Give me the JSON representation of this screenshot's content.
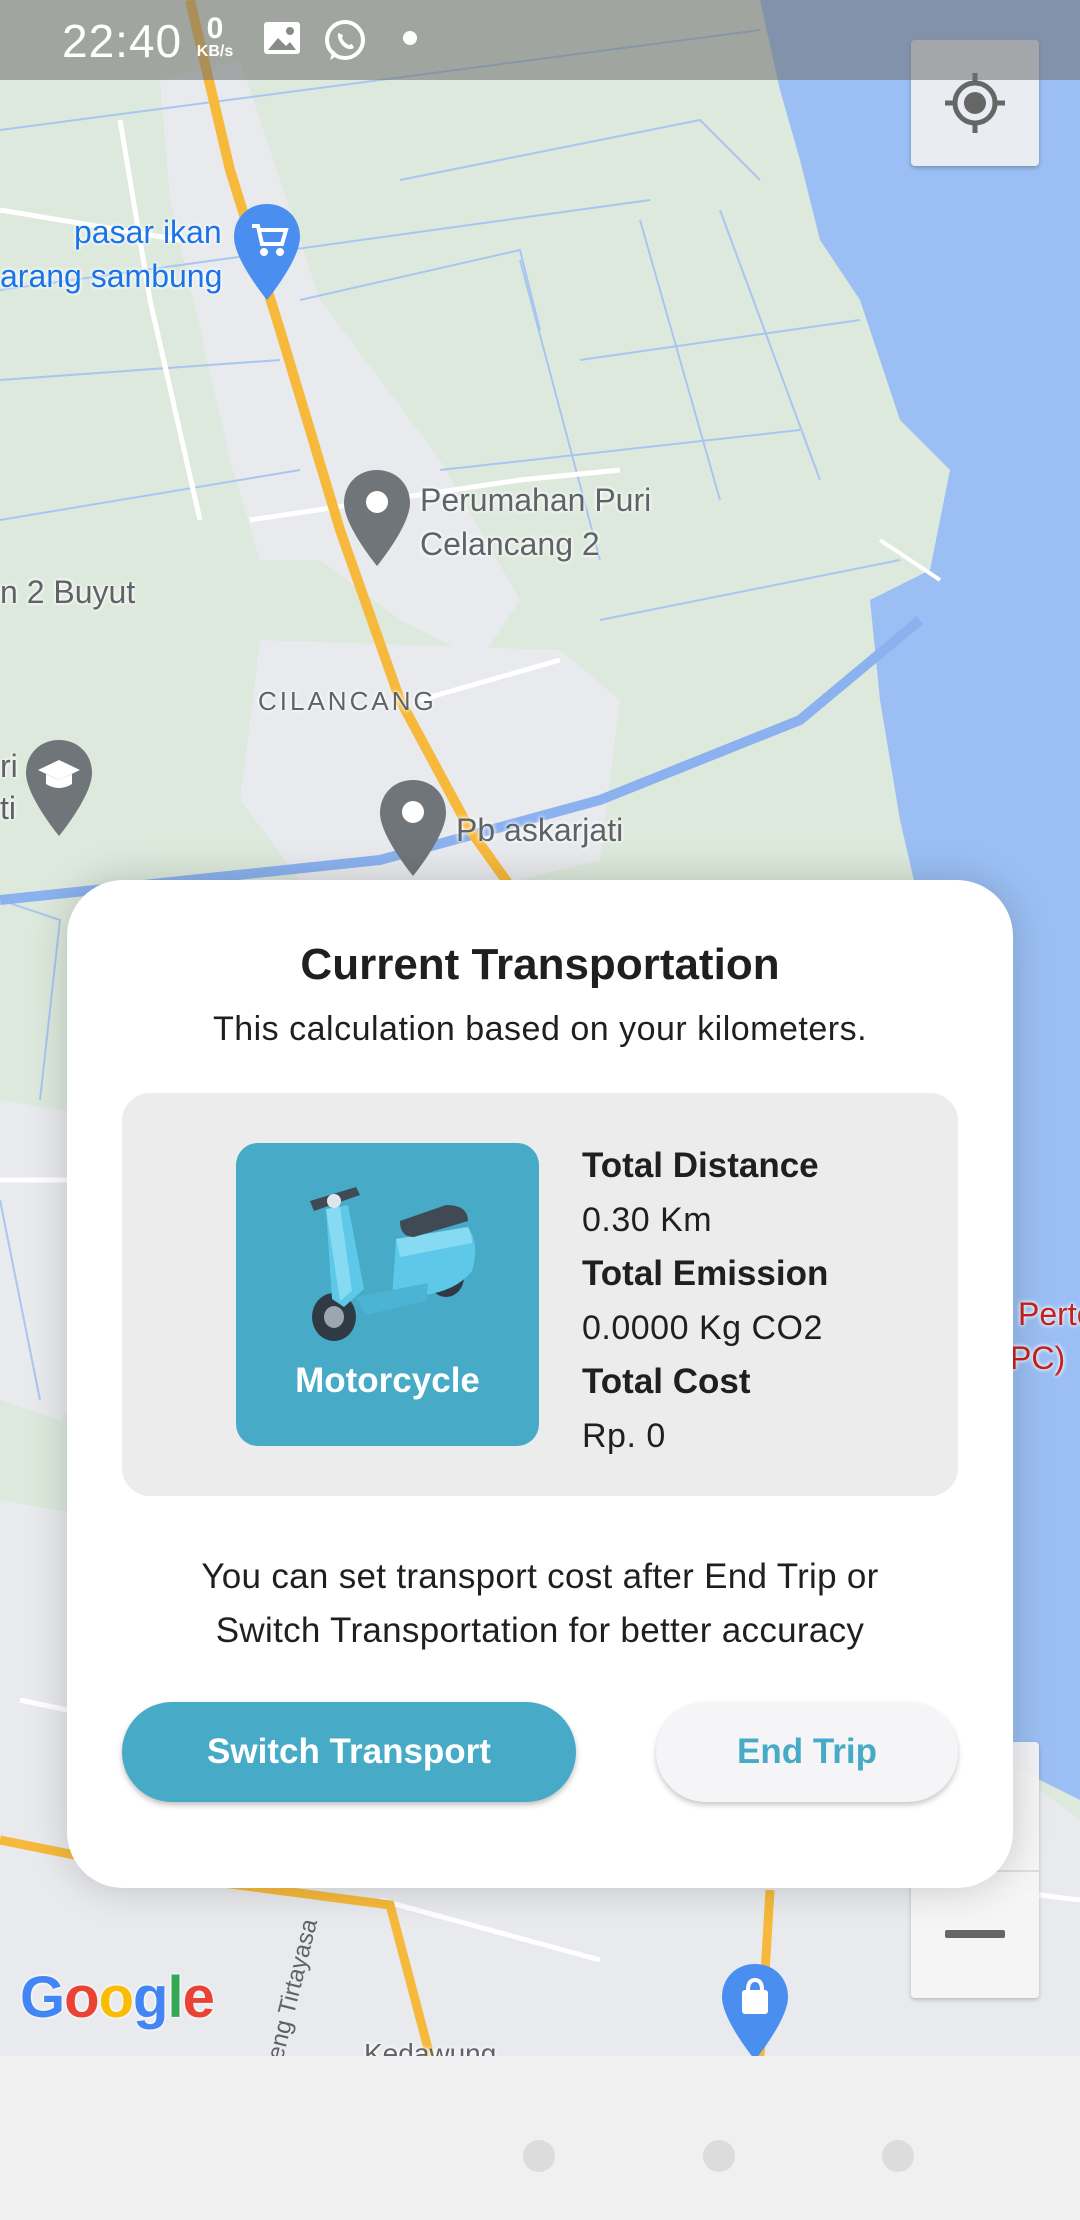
{
  "status_bar": {
    "time": "22:40",
    "net_speed_value": "0",
    "net_speed_unit": "KB/s",
    "icons": [
      "gallery-icon",
      "whatsapp-icon",
      "dot-icon"
    ]
  },
  "map": {
    "labels": {
      "pasar_ikan_1": "pasar ikan",
      "pasar_ikan_2": "arang sambung",
      "perumahan_1": "Perumahan Puri",
      "perumahan_2": "Celancang 2",
      "buyut": "n 2 Buyut",
      "cilancang": "CILANCANG",
      "pb_askarjati": "Pb askarjati",
      "edge_ri": "ri",
      "edge_ti": "ti",
      "perte_1": "Perte",
      "perte_2": "PC)",
      "road_tirtayasa": "eng Tirtayasa",
      "kedawung": "Kedawung"
    },
    "google_logo": {
      "letters": [
        "G",
        "o",
        "o",
        "g",
        "l",
        "e"
      ],
      "colors": [
        "#4285F4",
        "#EA4335",
        "#FBBC05",
        "#4285F4",
        "#34A853",
        "#EA4335"
      ]
    },
    "colors": {
      "land": "#dde9dc",
      "water": "#9bbff4",
      "urban": "#e8eaed",
      "highway": "#f6b93b",
      "pin_blue": "#4a8ff0",
      "pin_gray": "#70757a"
    }
  },
  "card": {
    "title": "Current Transportation",
    "subtitle": "This calculation based on your kilometers.",
    "vehicle": {
      "label": "Motorcycle",
      "icon": "scooter-icon"
    },
    "stats": {
      "distance_label": "Total Distance",
      "distance_value": "0.30 Km",
      "emission_label": "Total Emission",
      "emission_value": "0.0000 Kg CO2",
      "cost_label": "Total Cost",
      "cost_value": "Rp. 0"
    },
    "note_line1": "You can set transport cost after End Trip or",
    "note_line2": "Switch Transportation for better accuracy",
    "switch_button": "Switch Transport",
    "end_button": "End Trip",
    "accent": "#47aac6"
  }
}
